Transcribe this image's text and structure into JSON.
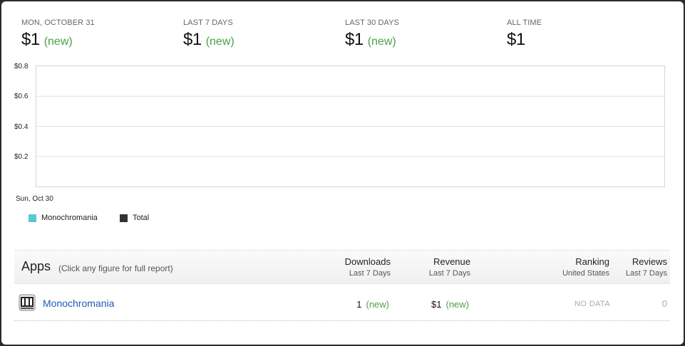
{
  "stats": [
    {
      "label": "MON, OCTOBER 31",
      "value": "$1",
      "note": "(new)"
    },
    {
      "label": "LAST 7 DAYS",
      "value": "$1",
      "note": "(new)"
    },
    {
      "label": "LAST 30 DAYS",
      "value": "$1",
      "note": "(new)"
    },
    {
      "label": "ALL TIME",
      "value": "$1",
      "note": ""
    }
  ],
  "chart_data": {
    "type": "line",
    "x": [
      "Sun, Oct 30"
    ],
    "series": [
      {
        "name": "Monochromania",
        "values": [],
        "color": "#5bc7d4"
      },
      {
        "name": "Total",
        "values": [],
        "color": "#333333"
      }
    ],
    "yticks": [
      "$0.8",
      "$0.6",
      "$0.4",
      "$0.2"
    ],
    "ylim": [
      0,
      0.8
    ],
    "grid": true,
    "legend": "bottom-left"
  },
  "apps": {
    "title": "Apps",
    "subtitle": "(Click any figure for full report)",
    "columns": [
      {
        "name": "Downloads",
        "sub": "Last 7 Days"
      },
      {
        "name": "Revenue",
        "sub": "Last 7 Days"
      },
      {
        "name": "Ranking",
        "sub": "United States"
      },
      {
        "name": "Reviews",
        "sub": "Last 7 Days"
      }
    ],
    "rows": [
      {
        "name": "Monochromania",
        "icon": "app-icon",
        "downloads": "1",
        "downloads_note": "(new)",
        "revenue": "$1",
        "revenue_note": "(new)",
        "ranking": "NO DATA",
        "reviews": "0"
      }
    ]
  }
}
